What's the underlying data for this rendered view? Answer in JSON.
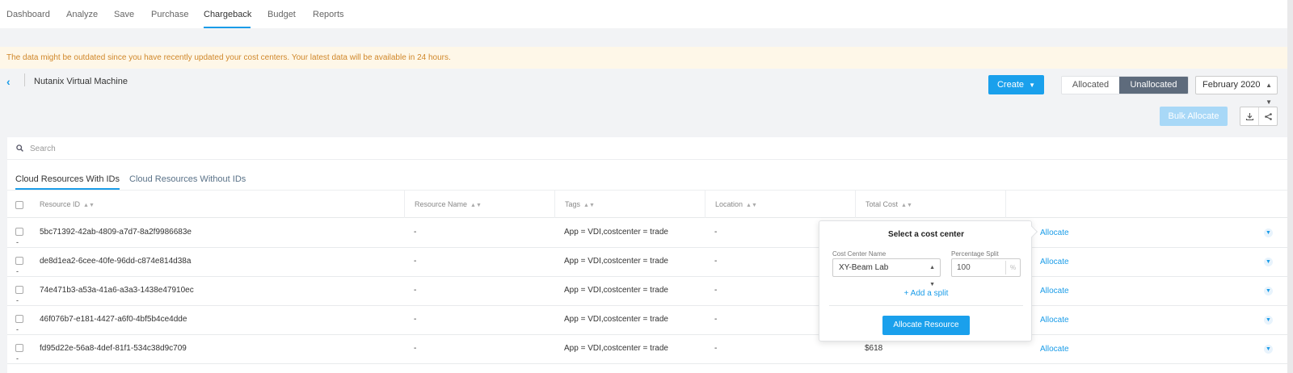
{
  "nav": {
    "tabs": [
      "Dashboard",
      "Analyze",
      "Save",
      "Purchase",
      "Chargeback",
      "Budget",
      "Reports"
    ],
    "active": "Chargeback"
  },
  "warning": "The data might be outdated since you have recently updated your cost centers. Your latest data will be available in 24 hours.",
  "breadcrumb": {
    "title": "Nutanix Virtual Machine"
  },
  "toolbar": {
    "create_label": "Create",
    "allocated_label": "Allocated",
    "unallocated_label": "Unallocated",
    "month": "February 2020",
    "bulk_allocate_label": "Bulk Allocate"
  },
  "search": {
    "placeholder": "Search"
  },
  "subtabs": [
    "Cloud Resources With IDs",
    "Cloud Resources Without IDs"
  ],
  "table": {
    "headers": [
      "Resource ID",
      "Resource Name",
      "Tags",
      "Location",
      "Total Cost"
    ],
    "allocate_label": "Allocate",
    "rows": [
      {
        "id": "5bc71392-42ab-4809-a7d7-8a2f9986683e",
        "name": "-",
        "tags": "App = VDI,costcenter = trade",
        "location": "-",
        "cost": ""
      },
      {
        "id": "de8d1ea2-6cee-40fe-96dd-c874e814d38a",
        "name": "-",
        "tags": "App = VDI,costcenter = trade",
        "location": "-",
        "cost": ""
      },
      {
        "id": "74e471b3-a53a-41a6-a3a3-1438e47910ec",
        "name": "-",
        "tags": "App = VDI,costcenter = trade",
        "location": "-",
        "cost": ""
      },
      {
        "id": "46f076b7-e181-4427-a6f0-4bf5b4ce4dde",
        "name": "-",
        "tags": "App = VDI,costcenter = trade",
        "location": "-",
        "cost": ""
      },
      {
        "id": "fd95d22e-56a8-4def-81f1-534c38d9c709",
        "name": "-",
        "tags": "App = VDI,costcenter = trade",
        "location": "-",
        "cost": "$618"
      }
    ]
  },
  "popover": {
    "title": "Select a cost center",
    "cost_center_label": "Cost Center Name",
    "cost_center_value": "XY-Beam Lab",
    "percentage_label": "Percentage Split",
    "percentage_value": "100",
    "percent_unit": "%",
    "add_split_label": "+ Add a split",
    "allocate_resource_label": "Allocate Resource"
  },
  "colors": {
    "accent": "#1aa0ec",
    "warning_text": "#d0872a",
    "warning_bg": "#fef7e8",
    "toggle_active": "#5e6b7c"
  }
}
